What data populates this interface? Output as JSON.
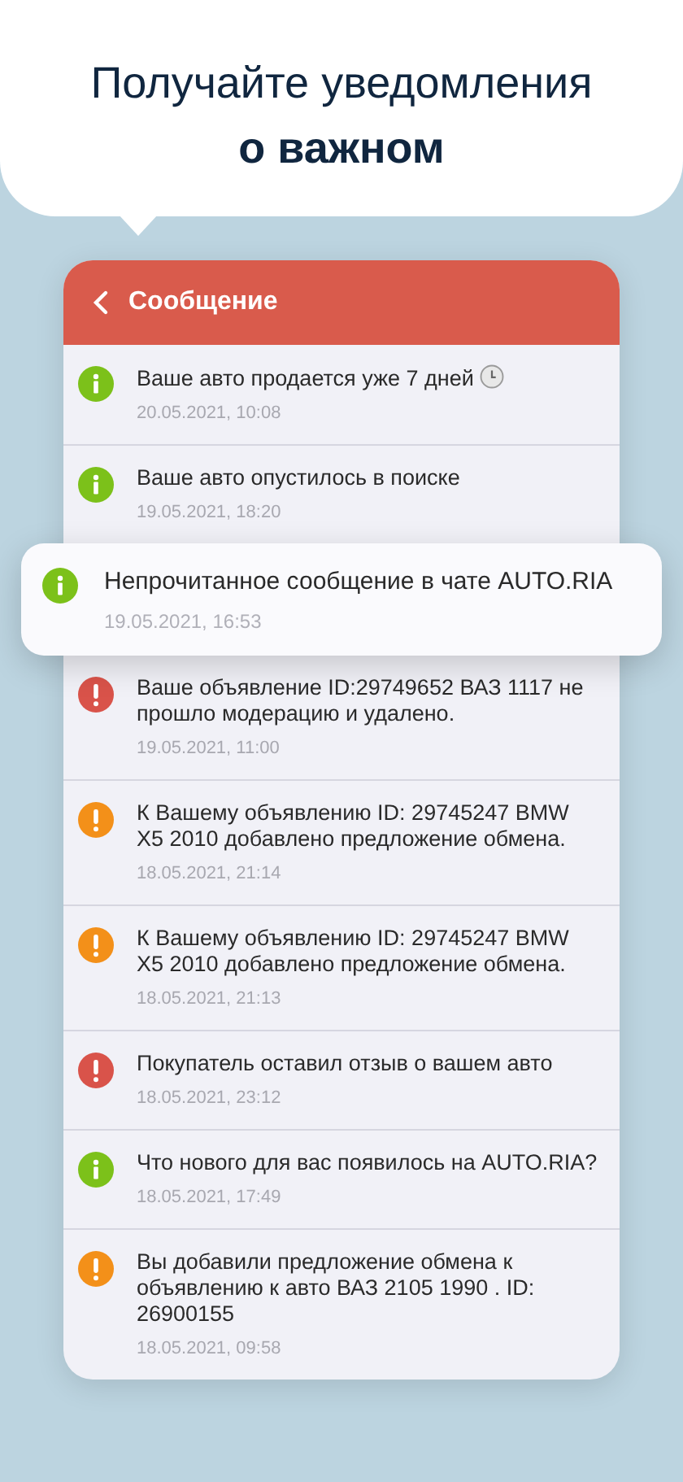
{
  "promo": {
    "title": "Получайте уведомления",
    "title_bold": "о важном"
  },
  "header": {
    "title": "Сообщение"
  },
  "messages": [
    {
      "kind": "info",
      "text": "Ваше авто продается уже 7 дней",
      "time": "20.05.2021, 10:08",
      "highlighted": false
    },
    {
      "kind": "info",
      "text": "Ваше авто опустилось в поиске",
      "time": "19.05.2021, 18:20",
      "highlighted": false
    },
    {
      "kind": "info",
      "text": "Непрочитанное сообщение в чате AUTO.RIA",
      "time": "19.05.2021, 16:53",
      "highlighted": true
    },
    {
      "kind": "error",
      "text": "Ваше объявление ID:29749652 ВАЗ 1117 не прошло модерацию и удалено.",
      "time": "19.05.2021, 11:00",
      "highlighted": false
    },
    {
      "kind": "warning",
      "text": "К Вашему объявлению ID: 29745247 BMW X5 2010 добавлено предложение обмена.",
      "time": "18.05.2021, 21:14",
      "highlighted": false
    },
    {
      "kind": "warning",
      "text": "К Вашему объявлению ID: 29745247 BMW X5 2010 добавлено предложение обмена.",
      "time": "18.05.2021, 21:13",
      "highlighted": false
    },
    {
      "kind": "error",
      "text": "Покупатель оставил отзыв о вашем авто",
      "time": "18.05.2021, 23:12",
      "highlighted": false
    },
    {
      "kind": "info",
      "text": "Что нового для вас появилось на AUTO.RIA?",
      "time": "18.05.2021, 17:49",
      "highlighted": false
    },
    {
      "kind": "warning",
      "text": "Вы добавили предложение обмена к объявлению к авто ВАЗ 2105 1990 . ID: 26900155",
      "time": "18.05.2021, 09:58",
      "highlighted": false
    }
  ]
}
